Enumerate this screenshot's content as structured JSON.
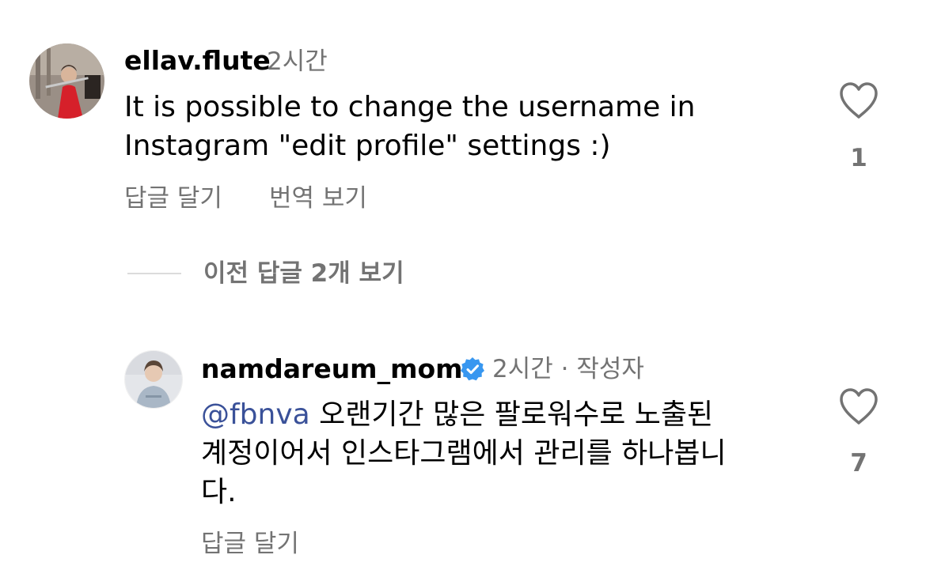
{
  "comments": [
    {
      "username": "ellav.flute",
      "time": "2시간",
      "text_lines": [
        "It is possible to change the username in",
        "Instagram \"edit profile\" settings :)"
      ],
      "like_count": "1",
      "actions": [
        "답글 달기",
        "번역 보기"
      ]
    },
    {
      "username": "namdareum_mom",
      "verified": true,
      "time": "2시간",
      "author_tag": "· 작성자",
      "mention": "@fbnva",
      "text_lines": [
        " 오랜기간 많은 팔로워수로  노출된",
        "계정이어서 인스타그램에서 관리를 하나봅니",
        "다."
      ],
      "like_count": "7",
      "actions": [
        "답글 달기"
      ]
    }
  ],
  "view_replies": {
    "prefix": "이전 답글 ",
    "count": "2",
    "suffix": "개 보기"
  },
  "colors": {
    "secondary_text": "#737373",
    "mention": "#3a5199",
    "verified_badge": "#3897f0"
  },
  "icons": {
    "like": "heart-outline-icon",
    "verified": "verified-badge-icon"
  }
}
